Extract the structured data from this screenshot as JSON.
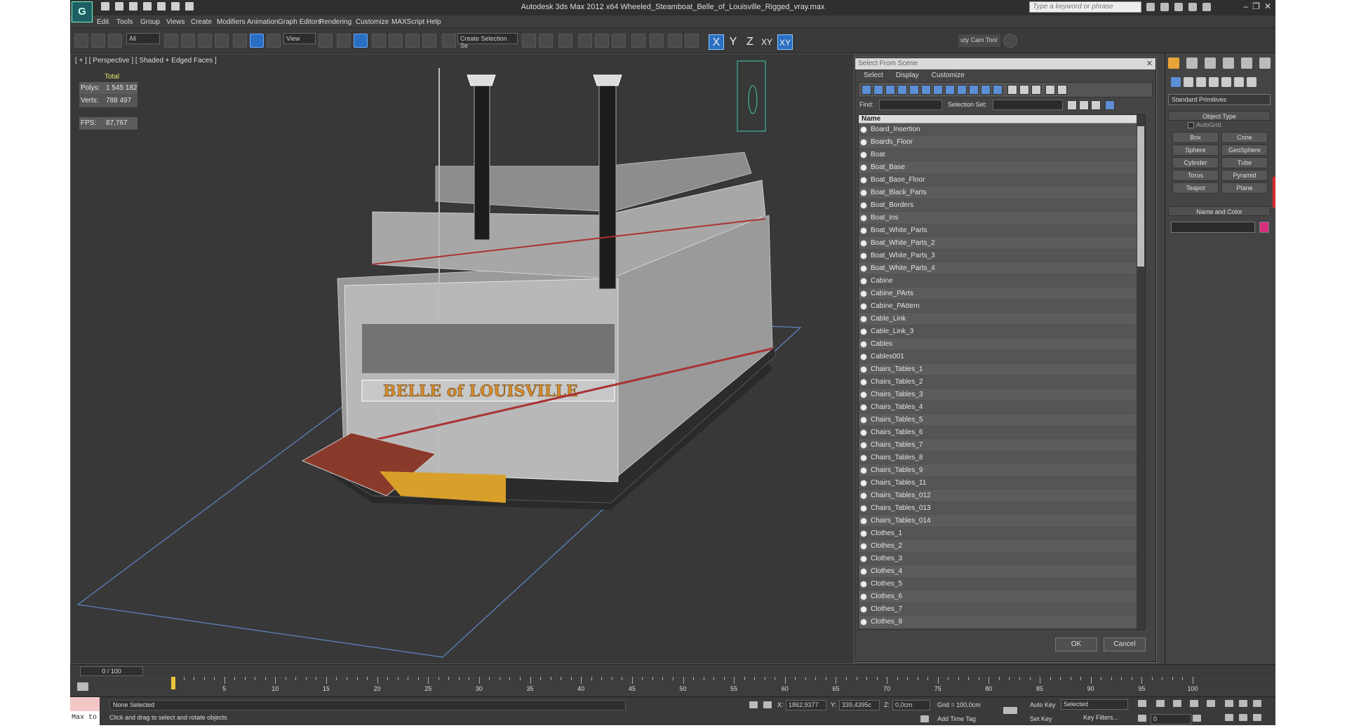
{
  "app": {
    "window_title": "Autodesk 3ds Max  2012 x64     Wheeled_Steamboat_Belle_of_Louisville_Rigged_vray.max",
    "search_placeholder": "Type a keyword or phrase"
  },
  "menu": [
    "Edit",
    "Tools",
    "Group",
    "Views",
    "Create",
    "Modifiers",
    "Animation",
    "Graph Editors",
    "Rendering",
    "Customize",
    "MAXScript",
    "Help"
  ],
  "toolbar": {
    "filter_dropdown": "All",
    "coord_dropdown": "View",
    "named_selection": "Create Selection Se",
    "axes": [
      "X",
      "Y",
      "Z",
      "XY",
      "XY"
    ],
    "cam_tool": "uty Cam Tool"
  },
  "viewport": {
    "label": "[ + ] [ Perspective ] [ Shaded + Edged Faces ]",
    "stats": {
      "total_label": "Total",
      "polys_label": "Polys:",
      "polys": "1 545 182",
      "verts_label": "Verts:",
      "verts": "788 497",
      "fps_label": "FPS:",
      "fps": "87,767"
    }
  },
  "dialog": {
    "title": "Select From Scene",
    "menu": [
      "Select",
      "Display",
      "Customize"
    ],
    "find_label": "Find:",
    "selection_set_label": "Selection Set:",
    "column_name": "Name",
    "items": [
      "Board_Insertion",
      "Boards_Floor",
      "Boat",
      "Boat_Base",
      "Boat_Base_Floor",
      "Boat_Black_Parts",
      "Boat_Borders",
      "Boat_Ins",
      "Boat_White_Parts",
      "Boat_White_Parts_2",
      "Boat_White_Parts_3",
      "Boat_White_Parts_4",
      "Cabine",
      "Cabine_PArts",
      "Cabine_PAttern",
      "Cable_Link",
      "Cable_Link_3",
      "Cables",
      "Cables001",
      "Chairs_Tables_1",
      "Chairs_Tables_2",
      "Chairs_Tables_3",
      "Chairs_Tables_4",
      "Chairs_Tables_5",
      "Chairs_Tables_6",
      "Chairs_Tables_7",
      "Chairs_Tables_8",
      "Chairs_Tables_9",
      "Chairs_Tables_11",
      "Chairs_Tables_012",
      "Chairs_Tables_013",
      "Chairs_Tables_014",
      "Clothes_1",
      "Clothes_2",
      "Clothes_3",
      "Clothes_4",
      "Clothes_5",
      "Clothes_6",
      "Clothes_7",
      "Clothes_8"
    ],
    "ok": "OK",
    "cancel": "Cancel"
  },
  "command_panel": {
    "category": "Standard Primitives",
    "object_type": "Object Type",
    "autogrid": "AutoGrid",
    "primitives": [
      "Box",
      "Cone",
      "Sphere",
      "GeoSphere",
      "Cylinder",
      "Tube",
      "Torus",
      "Pyramid",
      "Teapot",
      "Plane"
    ],
    "name_and_color": "Name and Color",
    "color": "#d7307f"
  },
  "timeline": {
    "slider": "0 / 100",
    "ticks": [
      5,
      10,
      15,
      20,
      25,
      30,
      35,
      40,
      45,
      50,
      55,
      60,
      65,
      70,
      75,
      80,
      85,
      90,
      95,
      100
    ]
  },
  "status": {
    "maxscript": "Max to",
    "selection": "None Selected",
    "prompt": "Click and drag to select and rotate objects",
    "x_label": "X:",
    "x": "1862,9377",
    "y_label": "Y:",
    "y": "339,4395c",
    "z_label": "Z:",
    "z": "0,0cm",
    "grid": "Grid = 100,0cm",
    "add_time_tag": "Add Time Tag",
    "auto_key": "Auto Key",
    "key_mode": "Selected",
    "set_key": "Set Key",
    "key_filters": "Key Filters...",
    "frame": "0"
  }
}
